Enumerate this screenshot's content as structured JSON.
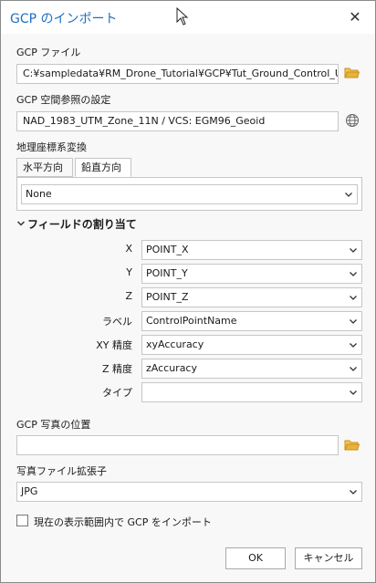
{
  "dialog": {
    "title": "GCP のインポート",
    "close_glyph": "✕"
  },
  "gcp_file": {
    "label": "GCP ファイル",
    "value": "C:¥sampledata¥RM_Drone_Tutorial¥GCP¥Tut_Ground_Control_UTM"
  },
  "gcp_sr": {
    "label": "GCP 空間参照の設定",
    "value": "NAD_1983_UTM_Zone_11N / VCS: EGM96_Geoid"
  },
  "geo_transform": {
    "label": "地理座標系変換",
    "tabs": [
      "水平方向",
      "鉛直方向"
    ],
    "active_tab": "鉛直方向",
    "value": "None"
  },
  "field_mapping": {
    "header": "フィールドの割り当て",
    "rows": [
      {
        "label": "X",
        "value": "POINT_X"
      },
      {
        "label": "Y",
        "value": "POINT_Y"
      },
      {
        "label": "Z",
        "value": "POINT_Z"
      },
      {
        "label": "ラベル",
        "value": "ControlPointName"
      },
      {
        "label": "XY 精度",
        "value": "xyAccuracy"
      },
      {
        "label": "Z 精度",
        "value": "zAccuracy"
      },
      {
        "label": "タイプ",
        "value": ""
      }
    ]
  },
  "photo_location": {
    "label": "GCP 写真の位置",
    "value": ""
  },
  "photo_ext": {
    "label": "写真ファイル拡張子",
    "value": "JPG"
  },
  "import_extent": {
    "label": "現在の表示範囲内で GCP をインポート",
    "checked": false
  },
  "buttons": {
    "ok": "OK",
    "cancel": "キャンセル"
  },
  "colors": {
    "accent": "#1f6fbf",
    "folder": "#e8b33a"
  }
}
